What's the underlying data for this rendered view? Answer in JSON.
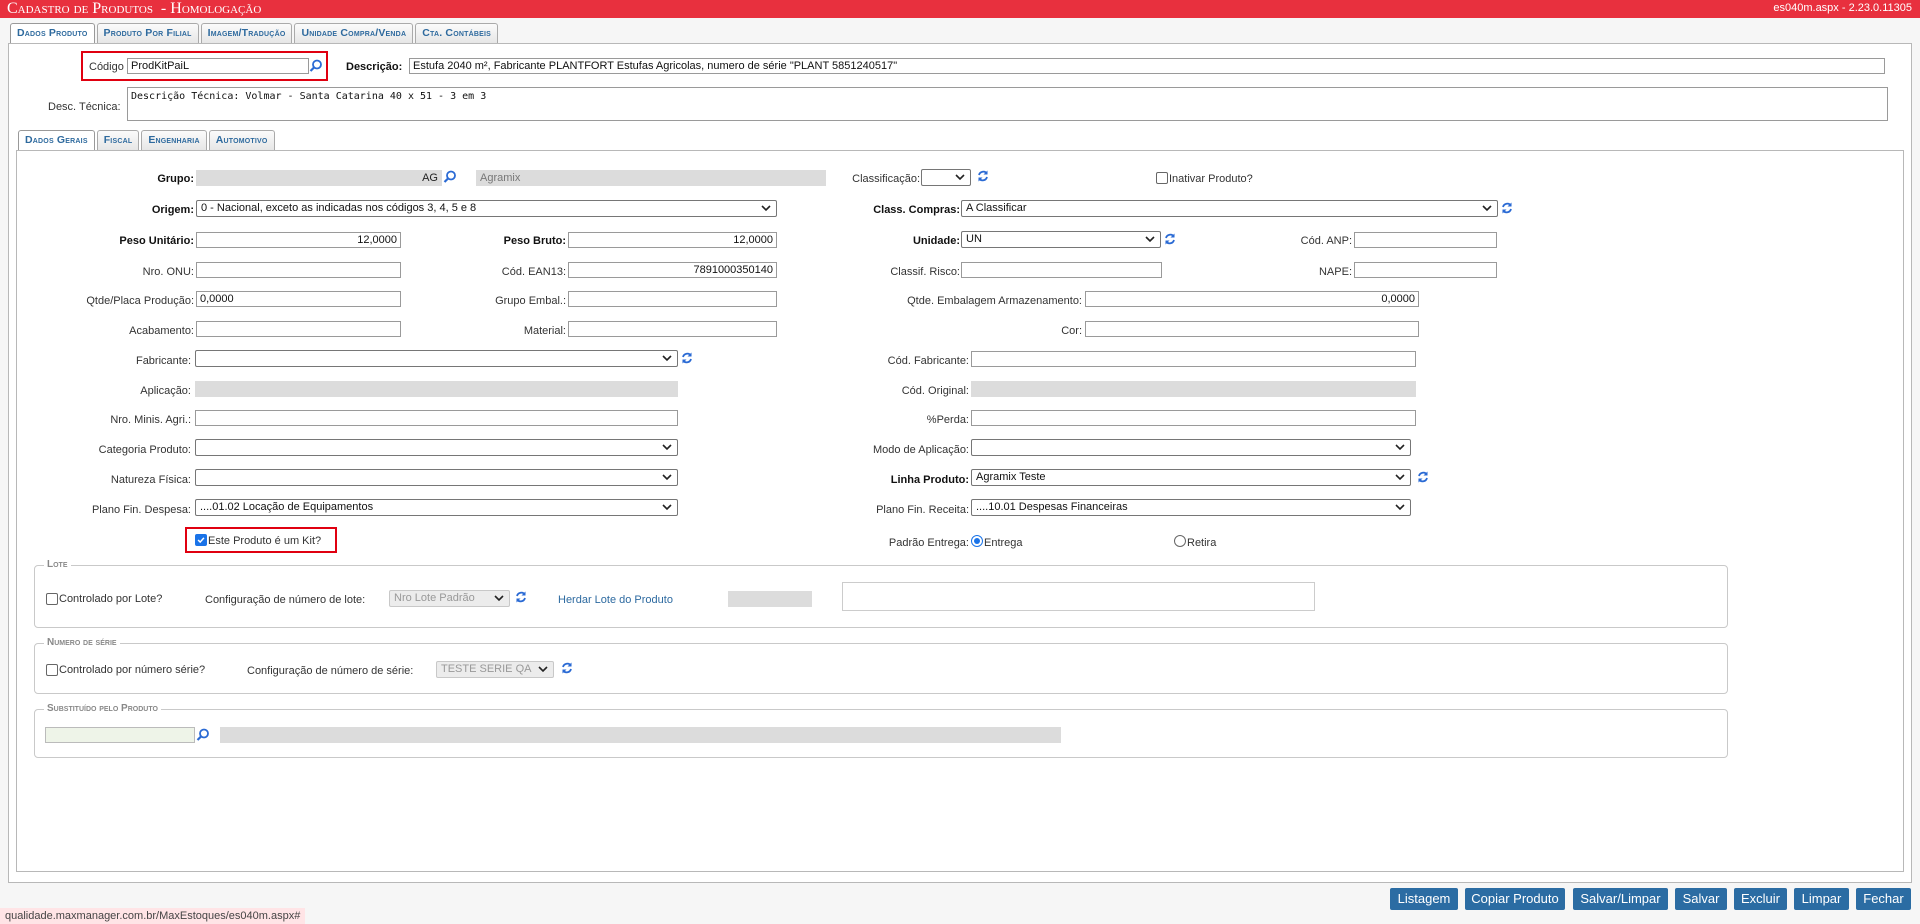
{
  "window": {
    "title": "Cadastro de Produtos  - Homologação",
    "version": "es040m.aspx - 2.23.0.11305"
  },
  "top_tabs": [
    "Dados Produto",
    "Produto Por Filial",
    "Imagem/Tradução",
    "Unidade Compra/Venda",
    "Cta. Contábeis"
  ],
  "header": {
    "codigo_label": "Código",
    "codigo_value": "ProdKitPaiL",
    "descricao_label": "Descrição:",
    "descricao_value": "Estufa 2040 m², Fabricante PLANTFORT Estufas Agricolas, numero de série \"PLANT 5851240517\"",
    "desc_tecnica_label": "Desc. Técnica:",
    "desc_tecnica_value": "Descrição Técnica: Volmar - Santa Catarina 40 x 51 - 3 em 3"
  },
  "sub_tabs": [
    "Dados Gerais",
    "Fiscal",
    "Engenharia",
    "Automotivo"
  ],
  "form": {
    "grupo_label": "Grupo:",
    "grupo_code": "AG",
    "grupo_name": "Agramix",
    "classificacao_label": "Classificação:",
    "inativar_label": "Inativar Produto?",
    "origem_label": "Origem:",
    "origem_value": "0 - Nacional, exceto as indicadas nos códigos 3, 4, 5 e 8",
    "class_compras_label": "Class. Compras:",
    "class_compras_value": "A Classificar",
    "peso_unit_label": "Peso Unitário:",
    "peso_unit_value": "12,0000",
    "peso_bruto_label": "Peso Bruto:",
    "peso_bruto_value": "12,0000",
    "unidade_label": "Unidade:",
    "unidade_value": "UN",
    "cod_anp_label": "Cód. ANP:",
    "nro_onu_label": "Nro. ONU:",
    "cod_ean_label": "Cód. EAN13:",
    "cod_ean_value": "7891000350140",
    "classif_risco_label": "Classif. Risco:",
    "nape_label": "NAPE:",
    "qtde_placa_label": "Qtde/Placa Produção:",
    "qtde_placa_value": "0,0000",
    "grupo_embal_label": "Grupo Embal.:",
    "qtde_emb_label": "Qtde. Embalagem Armazenamento:",
    "qtde_emb_value": "0,0000",
    "acabamento_label": "Acabamento:",
    "material_label": "Material:",
    "cor_label": "Cor:",
    "fabricante_label": "Fabricante:",
    "cod_fabricante_label": "Cód. Fabricante:",
    "aplicacao_label": "Aplicação:",
    "cod_original_label": "Cód. Original:",
    "nro_minis_label": "Nro. Minis. Agri.:",
    "perda_label": "%Perda:",
    "categoria_label": "Categoria Produto:",
    "modo_aplic_label": "Modo de Aplicação:",
    "natureza_label": "Natureza Física:",
    "linha_label": "Linha Produto:",
    "linha_value": "Agramix Teste",
    "plano_desp_label": "Plano Fin. Despesa:",
    "plano_desp_value": "....01.02 Locação de Equipamentos",
    "plano_rec_label": "Plano Fin. Receita:",
    "plano_rec_value": "....10.01 Despesas Financeiras",
    "kit_label": "Este Produto é um Kit?",
    "padrao_label": "Padrão Entrega:",
    "entrega_label": "Entrega",
    "retira_label": "Retira"
  },
  "lote": {
    "legend": "Lote",
    "controlado_label": "Controlado por Lote?",
    "config_label": "Configuração de número de lote:",
    "config_value": "Nro Lote Padrão",
    "herdar_link": "Herdar Lote do Produto"
  },
  "serie": {
    "legend": "Numero de série",
    "controlado_label": "Controlado por número série?",
    "config_label": "Configuração de número de série:",
    "config_value": "TESTE SERIE QA"
  },
  "substituido": {
    "legend": "Substituído pelo Produto"
  },
  "buttons": [
    "Listagem",
    "Copiar Produto",
    "Salvar/Limpar",
    "Salvar",
    "Excluir",
    "Limpar",
    "Fechar"
  ],
  "status_url": "qualidade.maxmanager.com.br/MaxEstoques/es040m.aspx#",
  "colors": {
    "title_bar": "#e8303e",
    "button": "#2b6ca3",
    "highlight": "#e00010",
    "link": "#2d6aa0"
  }
}
